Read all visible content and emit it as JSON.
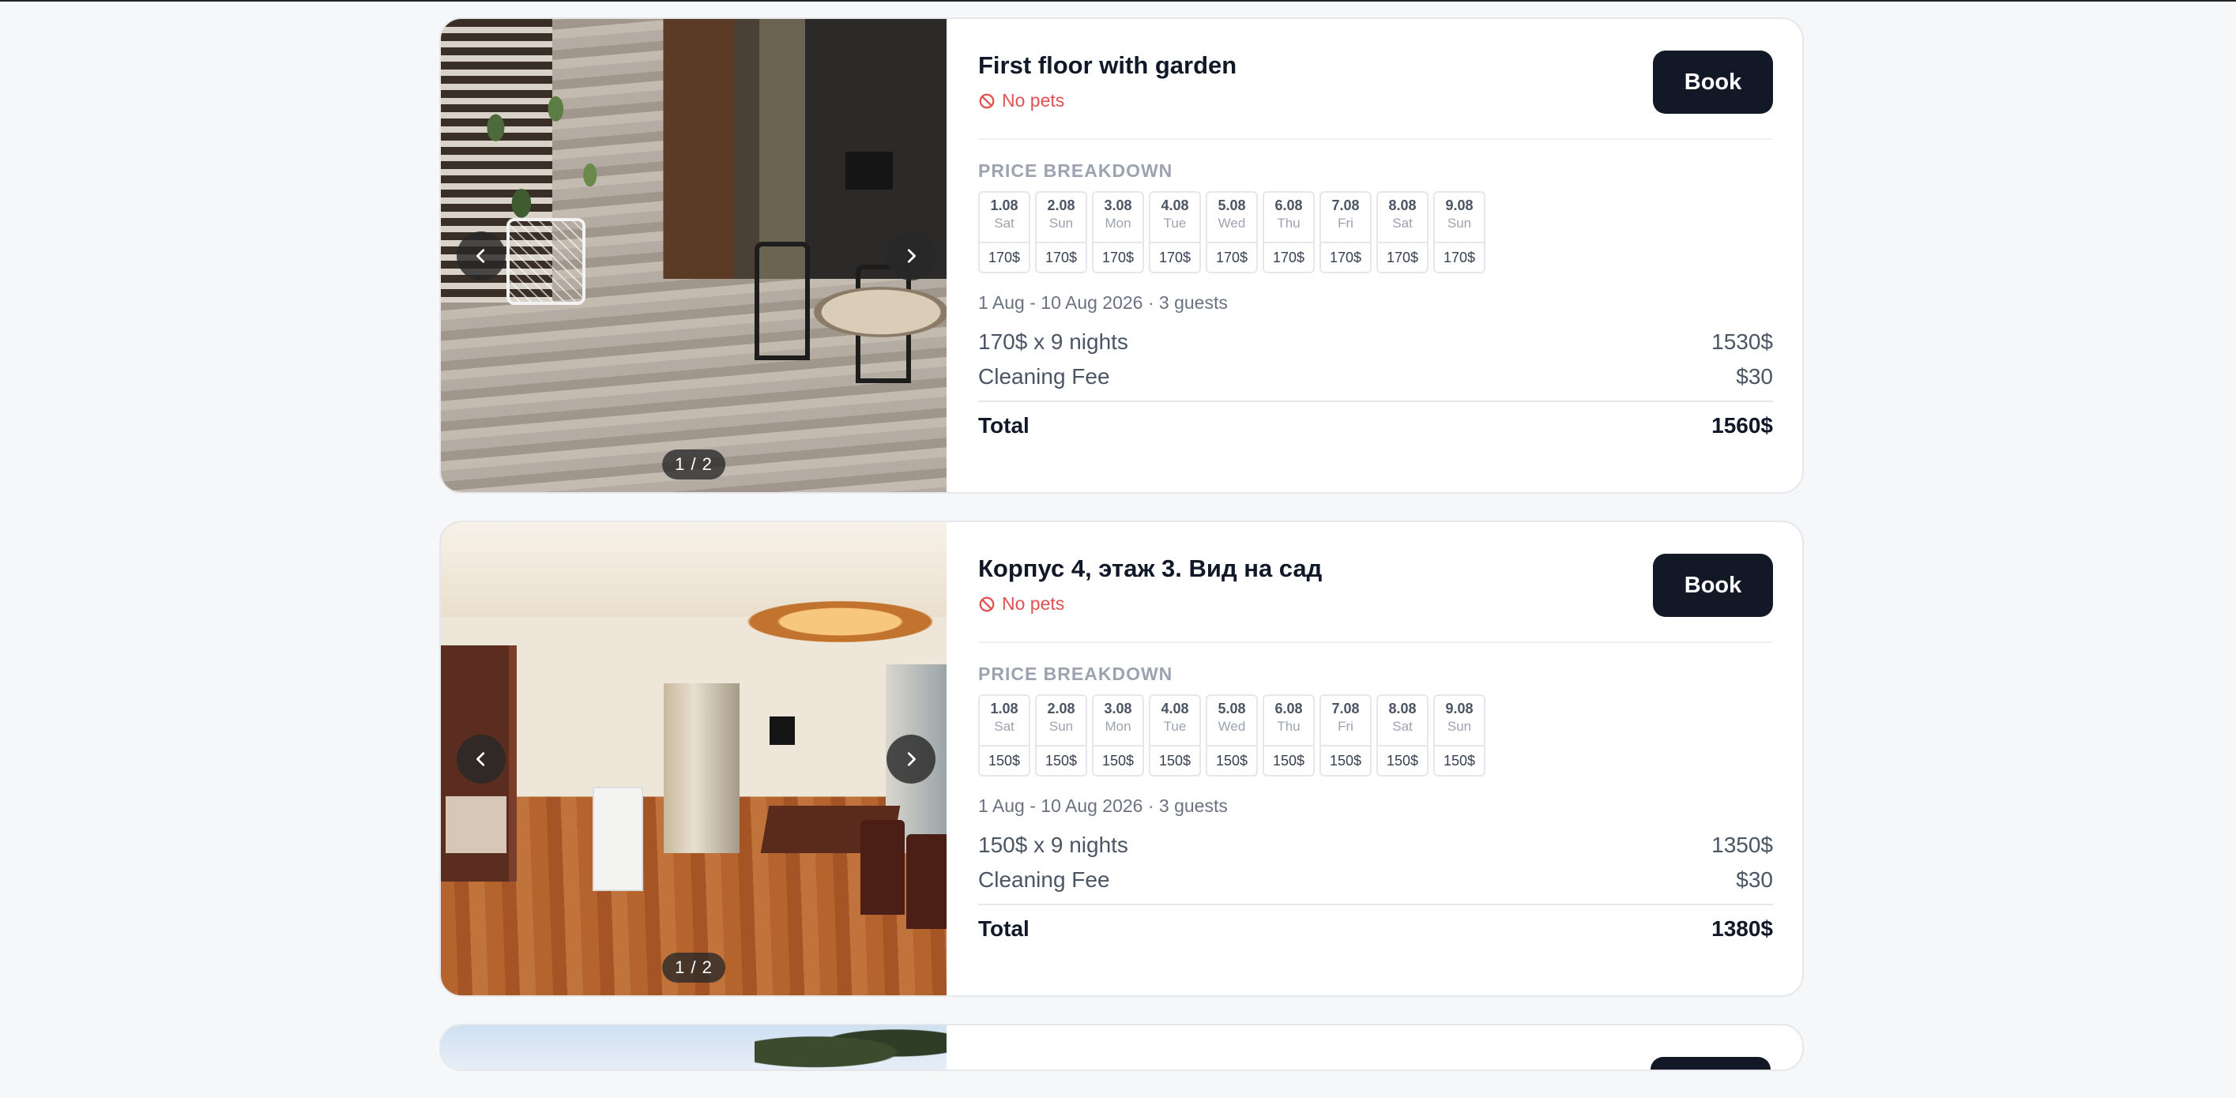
{
  "listings": [
    {
      "title": "First floor with garden",
      "pets": "No pets",
      "book_label": "Book",
      "price_breakdown_label": "PRICE BREAKDOWN",
      "image_counter": "1 / 2",
      "days": [
        {
          "date": "1.08",
          "weekday": "Sat",
          "price": "170$"
        },
        {
          "date": "2.08",
          "weekday": "Sun",
          "price": "170$"
        },
        {
          "date": "3.08",
          "weekday": "Mon",
          "price": "170$"
        },
        {
          "date": "4.08",
          "weekday": "Tue",
          "price": "170$"
        },
        {
          "date": "5.08",
          "weekday": "Wed",
          "price": "170$"
        },
        {
          "date": "6.08",
          "weekday": "Thu",
          "price": "170$"
        },
        {
          "date": "7.08",
          "weekday": "Fri",
          "price": "170$"
        },
        {
          "date": "8.08",
          "weekday": "Sat",
          "price": "170$"
        },
        {
          "date": "9.08",
          "weekday": "Sun",
          "price": "170$"
        }
      ],
      "dates_guests": "1 Aug - 10 Aug 2026 · 3 guests",
      "nights_label": "170$ x 9 nights",
      "nights_amount": "1530$",
      "fee_label": "Cleaning Fee",
      "fee_amount": "$30",
      "total_label": "Total",
      "total_amount": "1560$"
    },
    {
      "title": "Корпус 4, этаж 3. Вид на сад",
      "pets": "No pets",
      "book_label": "Book",
      "price_breakdown_label": "PRICE BREAKDOWN",
      "image_counter": "1 / 2",
      "days": [
        {
          "date": "1.08",
          "weekday": "Sat",
          "price": "150$"
        },
        {
          "date": "2.08",
          "weekday": "Sun",
          "price": "150$"
        },
        {
          "date": "3.08",
          "weekday": "Mon",
          "price": "150$"
        },
        {
          "date": "4.08",
          "weekday": "Tue",
          "price": "150$"
        },
        {
          "date": "5.08",
          "weekday": "Wed",
          "price": "150$"
        },
        {
          "date": "6.08",
          "weekday": "Thu",
          "price": "150$"
        },
        {
          "date": "7.08",
          "weekday": "Fri",
          "price": "150$"
        },
        {
          "date": "8.08",
          "weekday": "Sat",
          "price": "150$"
        },
        {
          "date": "9.08",
          "weekday": "Sun",
          "price": "150$"
        }
      ],
      "dates_guests": "1 Aug - 10 Aug 2026 · 3 guests",
      "nights_label": "150$ x 9 nights",
      "nights_amount": "1350$",
      "fee_label": "Cleaning Fee",
      "fee_amount": "$30",
      "total_label": "Total",
      "total_amount": "1380$"
    }
  ],
  "icons": {
    "prev": "chevron-left-icon",
    "next": "chevron-right-icon",
    "pets": "no-pets-icon"
  },
  "colors": {
    "book_button": "#121826",
    "no_pets": "#e05252",
    "section_label": "#9ca3af"
  }
}
